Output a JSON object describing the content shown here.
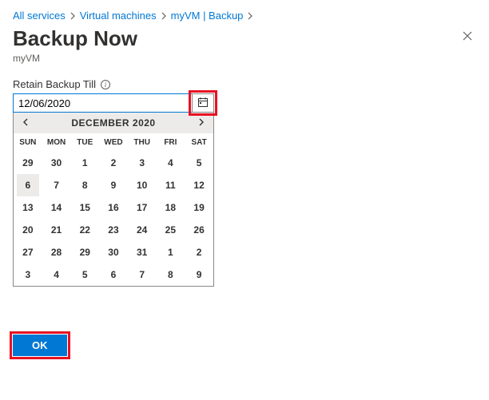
{
  "breadcrumb": {
    "items": [
      {
        "label": "All services"
      },
      {
        "label": "Virtual machines"
      },
      {
        "label": "myVM | Backup"
      }
    ]
  },
  "header": {
    "title": "Backup Now",
    "subtitle": "myVM"
  },
  "form": {
    "retain_label": "Retain Backup Till",
    "date_value": "12/06/2020"
  },
  "calendar": {
    "month_label": "DECEMBER 2020",
    "dow": [
      "SUN",
      "MON",
      "TUE",
      "WED",
      "THU",
      "FRI",
      "SAT"
    ],
    "selected_day": 6,
    "weeks": [
      [
        {
          "d": 29,
          "o": true
        },
        {
          "d": 30,
          "o": true
        },
        {
          "d": 1
        },
        {
          "d": 2
        },
        {
          "d": 3
        },
        {
          "d": 4
        },
        {
          "d": 5
        }
      ],
      [
        {
          "d": 6,
          "sel": true
        },
        {
          "d": 7
        },
        {
          "d": 8
        },
        {
          "d": 9
        },
        {
          "d": 10
        },
        {
          "d": 11
        },
        {
          "d": 12
        }
      ],
      [
        {
          "d": 13
        },
        {
          "d": 14
        },
        {
          "d": 15
        },
        {
          "d": 16
        },
        {
          "d": 17
        },
        {
          "d": 18
        },
        {
          "d": 19
        }
      ],
      [
        {
          "d": 20
        },
        {
          "d": 21
        },
        {
          "d": 22
        },
        {
          "d": 23
        },
        {
          "d": 24
        },
        {
          "d": 25
        },
        {
          "d": 26
        }
      ],
      [
        {
          "d": 27
        },
        {
          "d": 28
        },
        {
          "d": 29
        },
        {
          "d": 30
        },
        {
          "d": 31
        },
        {
          "d": 1,
          "o": true
        },
        {
          "d": 2,
          "o": true
        }
      ],
      [
        {
          "d": 3,
          "o": true
        },
        {
          "d": 4,
          "o": true
        },
        {
          "d": 5,
          "o": true
        },
        {
          "d": 6,
          "o": true
        },
        {
          "d": 7,
          "o": true
        },
        {
          "d": 8,
          "o": true
        },
        {
          "d": 9,
          "o": true
        }
      ]
    ]
  },
  "footer": {
    "ok_label": "OK"
  },
  "colors": {
    "link": "#0078d4",
    "highlight": "#e81123",
    "primary": "#0078d4"
  }
}
